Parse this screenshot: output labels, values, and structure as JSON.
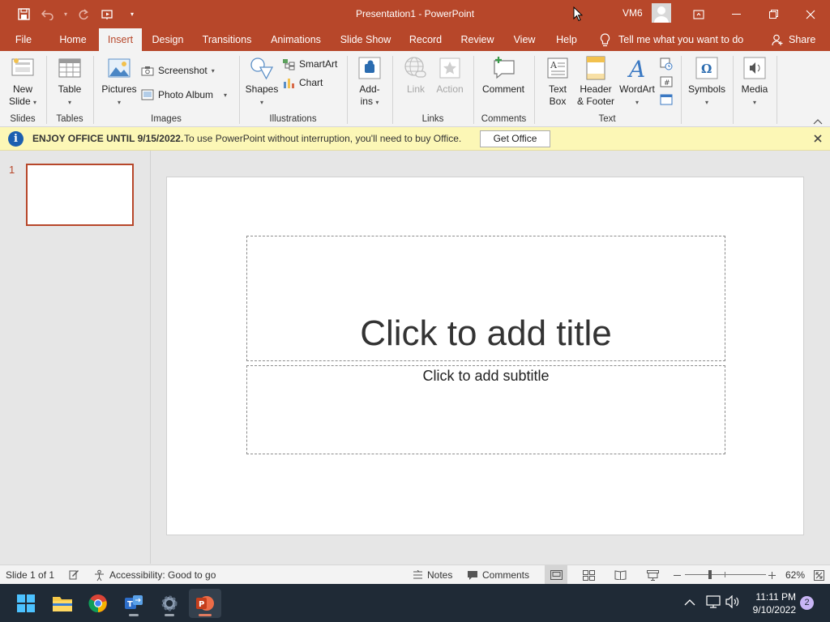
{
  "app": {
    "title": "Presentation1  -  PowerPoint",
    "user_name": "VM6",
    "accent": "#b7472a"
  },
  "tabs": [
    {
      "label": "File"
    },
    {
      "label": "Home"
    },
    {
      "label": "Insert"
    },
    {
      "label": "Design"
    },
    {
      "label": "Transitions"
    },
    {
      "label": "Animations"
    },
    {
      "label": "Slide Show"
    },
    {
      "label": "Record"
    },
    {
      "label": "Review"
    },
    {
      "label": "View"
    },
    {
      "label": "Help"
    }
  ],
  "active_tab": "Insert",
  "tell_me": "Tell me what you want to do",
  "share_label": "Share",
  "ribbon": {
    "slides": {
      "new_slide_1": "New",
      "new_slide_2": "Slide",
      "group": "Slides"
    },
    "tables": {
      "table": "Table",
      "group": "Tables"
    },
    "images": {
      "pictures": "Pictures",
      "screenshot": "Screenshot",
      "photo_album": "Photo Album",
      "group": "Images"
    },
    "illustrations": {
      "shapes": "Shapes",
      "smartart": "SmartArt",
      "chart": "Chart",
      "group": "Illustrations"
    },
    "addins": {
      "line1": "Add-",
      "line2": "ins"
    },
    "links": {
      "link": "Link",
      "action": "Action",
      "group": "Links"
    },
    "comments": {
      "comment": "Comment",
      "group": "Comments"
    },
    "text": {
      "textbox_1": "Text",
      "textbox_2": "Box",
      "header_1": "Header",
      "header_2": "& Footer",
      "wordart": "WordArt",
      "group": "Text"
    },
    "symbols": {
      "label": "Symbols"
    },
    "media": {
      "label": "Media"
    }
  },
  "infobar": {
    "title": "ENJOY OFFICE UNTIL 9/15/2022.",
    "message": "To use PowerPoint without interruption, you'll need to buy Office.",
    "button": "Get Office"
  },
  "slides_pane": {
    "number": "1"
  },
  "slide": {
    "title_placeholder": "Click to add title",
    "subtitle_placeholder": "Click to add subtitle"
  },
  "statusbar": {
    "slide_count": "Slide 1 of 1",
    "accessibility": "Accessibility: Good to go",
    "notes": "Notes",
    "comments": "Comments",
    "zoom": "62%",
    "zoom_level": 0.62
  },
  "taskbar": {
    "time": "11:11 PM",
    "date": "9/10/2022",
    "notifications": "2"
  }
}
